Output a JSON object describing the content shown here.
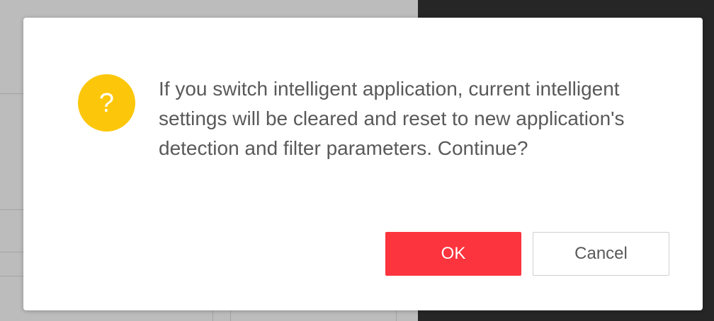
{
  "dialog": {
    "icon": "question-icon",
    "icon_glyph": "?",
    "message": "If you switch intelligent application, current intelligent settings will be cleared and reset to new application's detection and filter parameters. Continue?",
    "ok_label": "OK",
    "cancel_label": "Cancel"
  },
  "colors": {
    "icon_background": "#fcc70b",
    "ok_button": "#fb343e",
    "overlay_dark": "#262626",
    "message_text": "#595959"
  }
}
